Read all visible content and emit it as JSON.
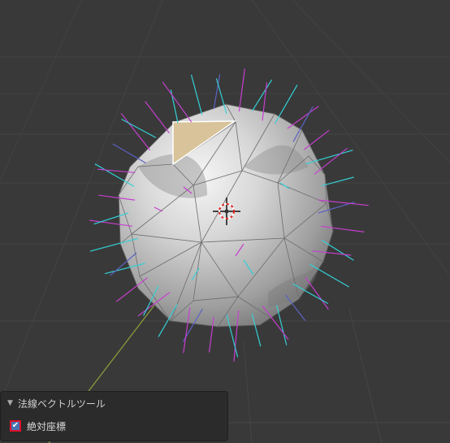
{
  "panel": {
    "title": "法線ベクトルツール",
    "collapse_icon": "triangle-down-icon",
    "absolute_coords": {
      "label": "絶対座標",
      "checked": true,
      "check_glyph": "✔"
    }
  },
  "viewport": {
    "background": "#393939",
    "grid_color": "#444444",
    "x_axis_color": "#8a9a3a",
    "normal_colors": [
      "#34d0d6",
      "#c63fcf",
      "#5c62c4"
    ],
    "selected_face_color": "#d8c39a"
  }
}
